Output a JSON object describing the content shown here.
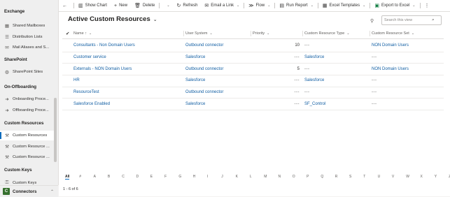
{
  "sidebar": {
    "groups": [
      {
        "heading": "Exchange",
        "items": [
          {
            "icon": "building-icon",
            "label": "Shared Mailboxes"
          },
          {
            "icon": "list-icon",
            "label": "Distribution Lists"
          },
          {
            "icon": "mail-icon",
            "label": "Mail Aliases and S..."
          }
        ]
      },
      {
        "heading": "SharePoint",
        "items": [
          {
            "icon": "globe-icon",
            "label": "SharePoint Sites"
          }
        ]
      },
      {
        "heading": "On-Offboarding",
        "items": [
          {
            "icon": "arrow-in-icon",
            "label": "Onboarding Proce..."
          },
          {
            "icon": "arrow-out-icon",
            "label": "Offboarding Proce..."
          }
        ]
      },
      {
        "heading": "Custom Resources",
        "items": [
          {
            "icon": "wrench-icon",
            "label": "Custom Resources",
            "active": true
          },
          {
            "icon": "wrench-icon",
            "label": "Custom Resource ..."
          },
          {
            "icon": "wrench-icon",
            "label": "Custom Resource ..."
          }
        ]
      },
      {
        "heading": "Custom Keys",
        "items": [
          {
            "icon": "key-icon",
            "label": "Custom Keys"
          }
        ]
      }
    ],
    "area": {
      "badge": "C",
      "name": "Connectors"
    }
  },
  "toolbar": {
    "show_chart": "Show Chart",
    "new": "New",
    "delete": "Delete",
    "refresh": "Refresh",
    "email_link": "Email a Link",
    "flow": "Flow",
    "run_report": "Run Report",
    "excel_templates": "Excel Templates",
    "export_excel": "Export to Excel"
  },
  "view": {
    "title": "Active Custom Resources",
    "search_placeholder": "Search this view"
  },
  "grid": {
    "columns": {
      "name": "Name ↑",
      "user_system": "User System",
      "priority": "Priority",
      "type": "Custom Resource Type",
      "set": "Custom Resource Set"
    },
    "rows": [
      {
        "name": "Consultants - Non Domain Users",
        "system": "Outbound connector",
        "priority": "10",
        "type": "---",
        "set": "NON Domain Users"
      },
      {
        "name": "Customer service",
        "system": "Salesforce",
        "priority": "---",
        "type": "Salesforce",
        "set": "---"
      },
      {
        "name": "Externals - NON Domain Users",
        "system": "Outbound connector",
        "priority": "5",
        "type": "---",
        "set": "NON Domain Users"
      },
      {
        "name": "HR",
        "system": "Salesforce",
        "priority": "---",
        "type": "Salesforce",
        "set": "---"
      },
      {
        "name": "ResourceTest",
        "system": "Outbound connector",
        "priority": "---",
        "type": "---",
        "set": "---"
      },
      {
        "name": "Salesforce Enabled",
        "system": "Salesforce",
        "priority": "---",
        "type": "SF_Control",
        "set": "---"
      }
    ]
  },
  "alphabet": [
    "All",
    "#",
    "A",
    "B",
    "C",
    "D",
    "E",
    "F",
    "G",
    "H",
    "I",
    "J",
    "K",
    "L",
    "M",
    "N",
    "O",
    "P",
    "Q",
    "R",
    "S",
    "T",
    "U",
    "V",
    "W",
    "X",
    "Y",
    "Z"
  ],
  "record_count": "1 - 6 of 6"
}
